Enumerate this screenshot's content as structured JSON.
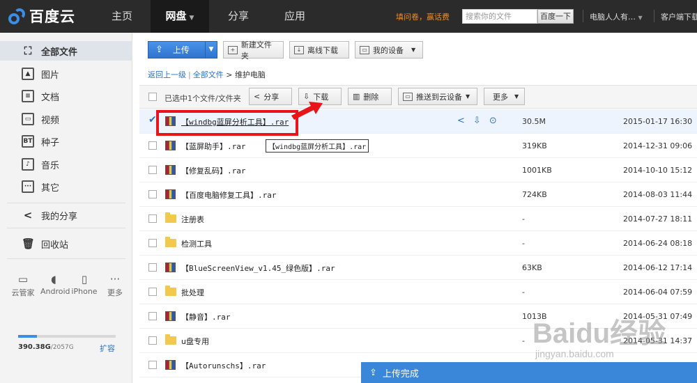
{
  "topbar": {
    "brand": "百度云",
    "nav": [
      "主页",
      "网盘",
      "分享",
      "应用"
    ],
    "promo": "填问卷，赢话费",
    "search_placeholder": "搜索你的文件",
    "search_button": "百度一下",
    "user": "电脑人人有…",
    "client_download": "客户端下载"
  },
  "sidebar": {
    "items": [
      {
        "label": "全部文件",
        "icon": "all-files-icon"
      },
      {
        "label": "图片",
        "icon": "image-icon"
      },
      {
        "label": "文档",
        "icon": "document-icon"
      },
      {
        "label": "视频",
        "icon": "video-icon"
      },
      {
        "label": "种子",
        "icon": "bt-icon"
      },
      {
        "label": "音乐",
        "icon": "music-icon"
      },
      {
        "label": "其它",
        "icon": "other-icon"
      },
      {
        "label": "我的分享",
        "icon": "share-icon"
      },
      {
        "label": "回收站",
        "icon": "trash-icon"
      }
    ],
    "bt_glyph": "BT",
    "devices": [
      "云管家",
      "Android",
      "iPhone",
      "更多"
    ],
    "quota_used": "390.38G",
    "quota_total": "/2057G",
    "quota_fraction": 0.19,
    "expand": "扩容"
  },
  "toolbar": {
    "upload": "上传",
    "new_folder": "新建文件夹",
    "offline_download": "离线下载",
    "my_devices": "我的设备"
  },
  "breadcrumb": {
    "back": "返回上一级",
    "all_files": "全部文件",
    "sep": ">",
    "current": "维护电脑"
  },
  "actionbar": {
    "selected_info": "已选中1个文件/文件夹",
    "share": "分享",
    "download": "下载",
    "delete": "删除",
    "push": "推送到云设备",
    "more": "更多"
  },
  "files": [
    {
      "name": "【windbg蓝屏分析工具】.rar",
      "type": "rar",
      "size": "30.5M",
      "date": "2015-01-17 16:30",
      "selected": true
    },
    {
      "name": "【蓝屏助手】.rar",
      "type": "rar",
      "size": "319KB",
      "date": "2014-12-31 09:06"
    },
    {
      "name": "【修复乱码】.rar",
      "type": "rar",
      "size": "1001KB",
      "date": "2014-10-10 15:12"
    },
    {
      "name": "【百度电脑修复工具】.rar",
      "type": "rar",
      "size": "724KB",
      "date": "2014-08-03 11:44"
    },
    {
      "name": "注册表",
      "type": "folder",
      "size": "-",
      "date": "2014-07-27 18:11"
    },
    {
      "name": "检测工具",
      "type": "folder",
      "size": "-",
      "date": "2014-06-24 08:18"
    },
    {
      "name": "【BlueScreenView_v1.45_绿色版】.rar",
      "type": "rar",
      "size": "63KB",
      "date": "2014-06-12 17:14"
    },
    {
      "name": "批处理",
      "type": "folder",
      "size": "-",
      "date": "2014-06-04 07:59"
    },
    {
      "name": "【静音】.rar",
      "type": "rar",
      "size": "1013B",
      "date": "2014-05-31 07:49"
    },
    {
      "name": "u盘专用",
      "type": "folder",
      "size": "-",
      "date": "2014-05-31 14:37"
    },
    {
      "name": "【Autorunschs】.rar",
      "type": "rar",
      "size": "",
      "date": ""
    }
  ],
  "tooltip": "【windbg蓝屏分析工具】.rar",
  "toast": "上传完成",
  "watermark": "Baidu经验",
  "watermark_url": "jingyan.baidu.com",
  "colors": {
    "accent": "#3a87d9",
    "highlight": "#e8141a",
    "topbar": "#2b2b2b"
  }
}
